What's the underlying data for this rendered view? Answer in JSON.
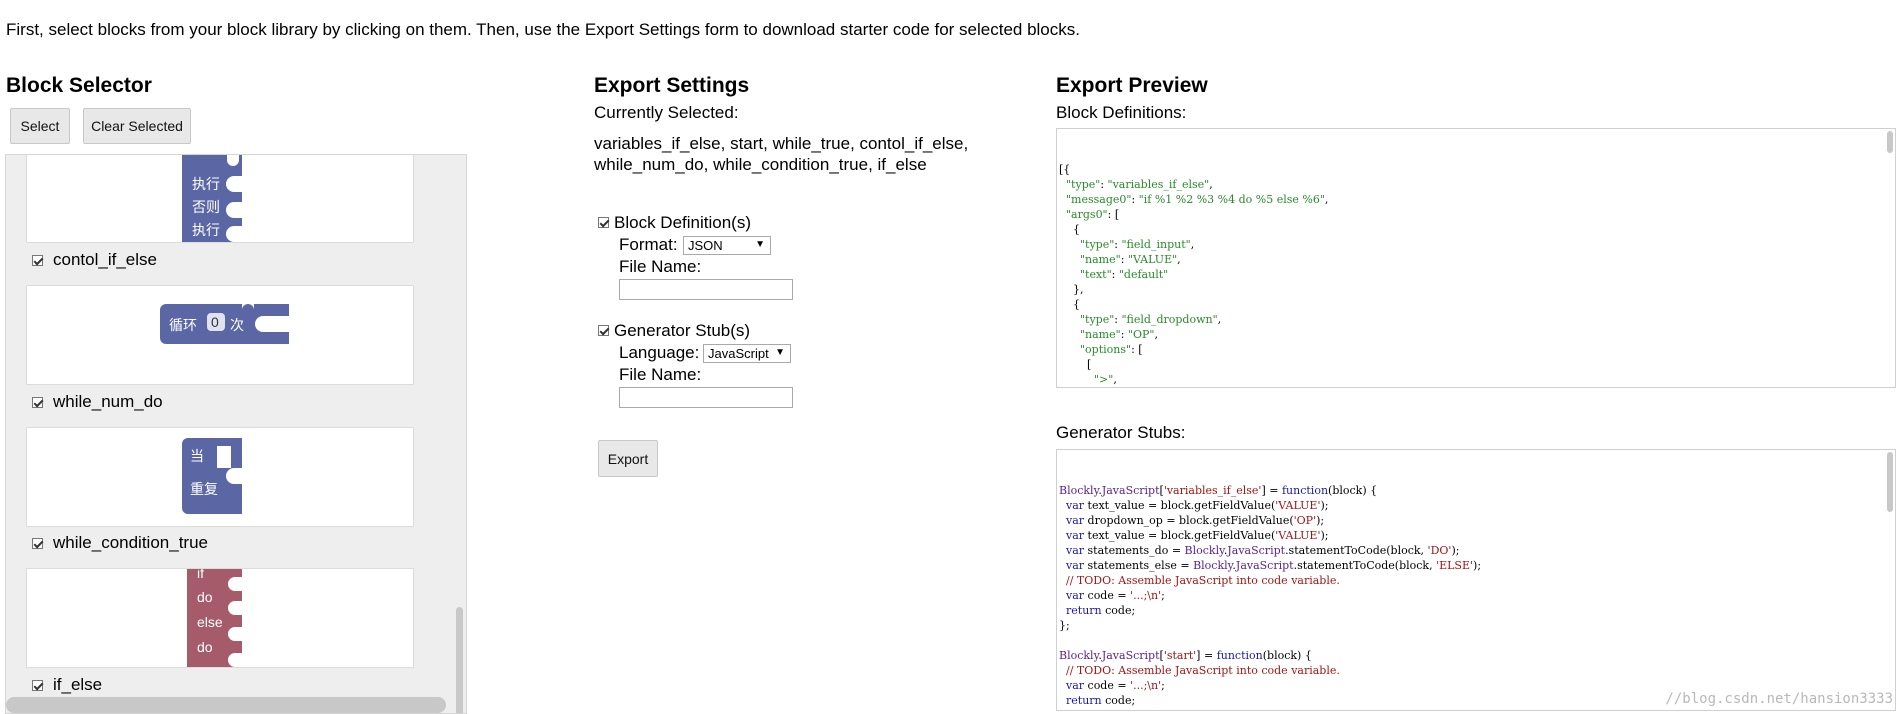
{
  "intro": "First, select blocks from your block library by clicking on them. Then, use the Export Settings form to download starter code for selected blocks.",
  "block_selector": {
    "title": "Block Selector",
    "select_button": "Select",
    "clear_button": "Clear Selected",
    "blocks": [
      {
        "name": "contol_if_else",
        "checked": true,
        "labels": [
          "执行",
          "否则",
          "执行"
        ],
        "color": "#5b67a5"
      },
      {
        "name": "while_num_do",
        "checked": true,
        "labels": [
          "循环",
          "0",
          "次"
        ],
        "color": "#5b67a5"
      },
      {
        "name": "while_condition_true",
        "checked": true,
        "labels": [
          "当",
          "重复"
        ],
        "color": "#5b67a5"
      },
      {
        "name": "if_else",
        "checked": true,
        "labels": [
          "if",
          "do",
          "else",
          "do"
        ],
        "color": "#a55b6a"
      }
    ]
  },
  "export_settings": {
    "title": "Export Settings",
    "currently_selected_label": "Currently Selected:",
    "currently_selected_value_line1": "variables_if_else, start, while_true, contol_if_else,",
    "currently_selected_value_line2": "while_num_do, while_condition_true, if_else",
    "block_definitions_label": "Block Definition(s)",
    "format_label": "Format:",
    "format_value": "JSON",
    "file_name_label_1": "File Name:",
    "generator_stubs_label": "Generator Stub(s)",
    "language_label": "Language:",
    "language_value": "JavaScript",
    "file_name_label_2": "File Name:",
    "export_button": "Export"
  },
  "export_preview": {
    "title": "Export Preview",
    "block_definitions_label": "Block Definitions:",
    "generator_stubs_label": "Generator Stubs:"
  },
  "watermark": "//blog.csdn.net/hansion3333"
}
